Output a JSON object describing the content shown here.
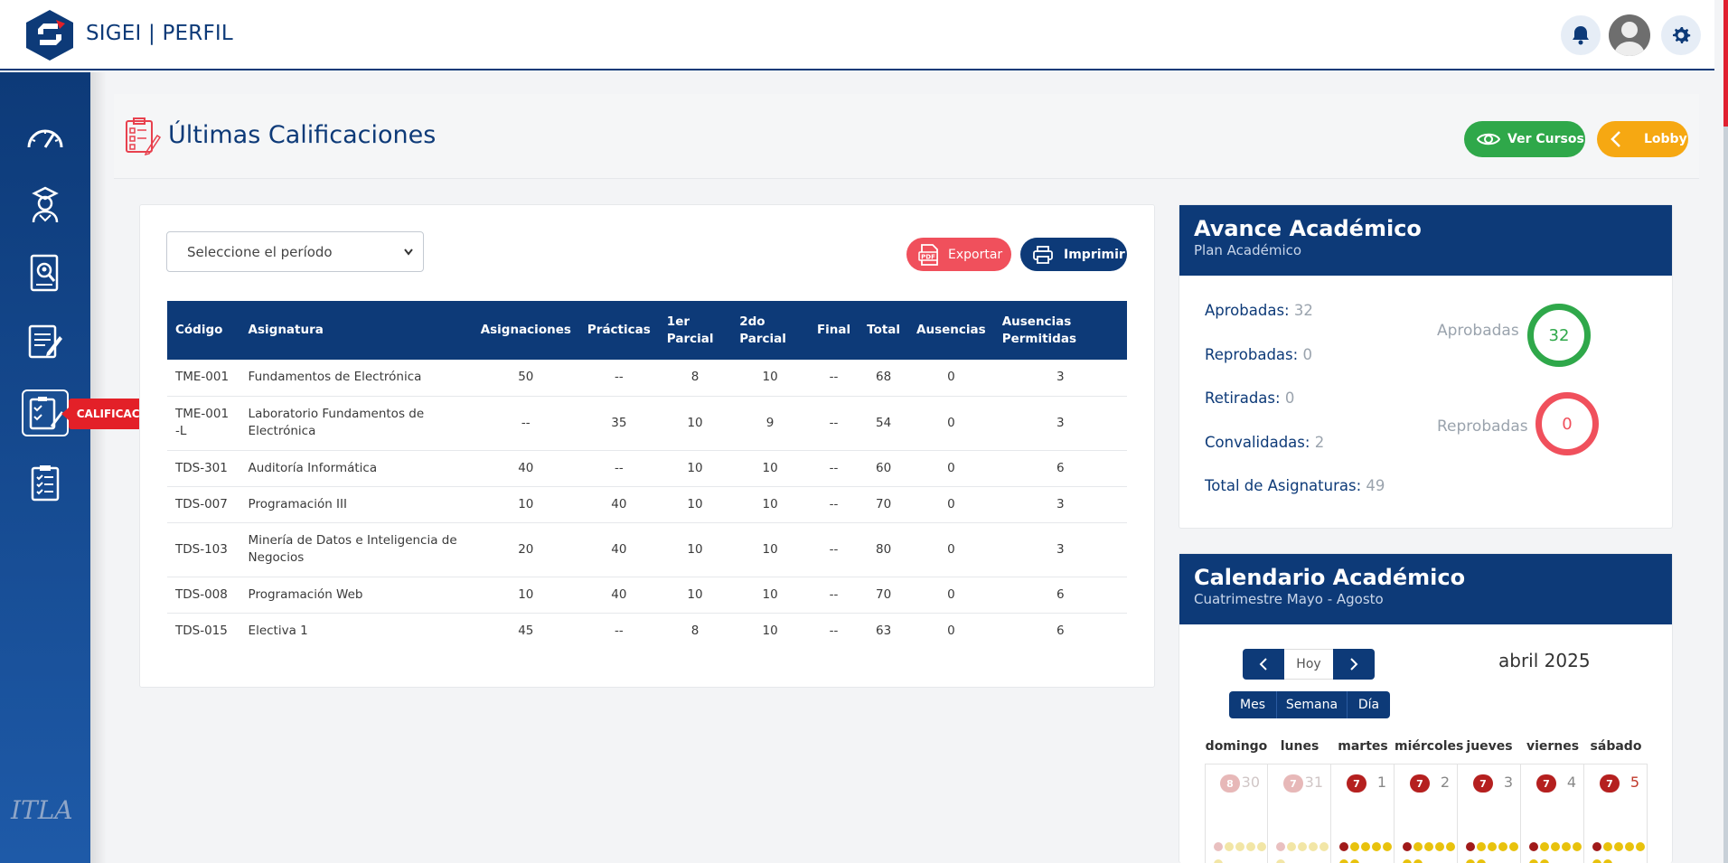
{
  "app": {
    "brand": "SIGEI | PERFIL"
  },
  "sidebar": {
    "tooltip": "CALIFICACIÓN",
    "items": [
      {
        "name": "dashboard"
      },
      {
        "name": "students"
      },
      {
        "name": "records"
      },
      {
        "name": "notes"
      },
      {
        "name": "grades"
      },
      {
        "name": "clipboard"
      }
    ],
    "footer_logo": "ITLA"
  },
  "header": {
    "title": "Últimas Calificaciones",
    "ver_cursos": "Ver Cursos",
    "lobby": "Lobby"
  },
  "filters": {
    "period_placeholder": "Seleccione el período",
    "export_label": "Exportar",
    "print_label": "Imprimir"
  },
  "table": {
    "headers": [
      "Código",
      "Asignatura",
      "Asignaciones",
      "Prácticas",
      "1er Parcial",
      "2do Parcial",
      "Final",
      "Total",
      "Ausencias",
      "Ausencias Permitidas"
    ],
    "rows": [
      [
        "TME-001",
        "Fundamentos de Electrónica",
        "50",
        "--",
        "8",
        "10",
        "--",
        "68",
        "0",
        "3"
      ],
      [
        "TME-001-L",
        "Laboratorio Fundamentos de Electrónica",
        "--",
        "35",
        "10",
        "9",
        "--",
        "54",
        "0",
        "3"
      ],
      [
        "TDS-301",
        "Auditoría Informática",
        "40",
        "--",
        "10",
        "10",
        "--",
        "60",
        "0",
        "6"
      ],
      [
        "TDS-007",
        "Programación III",
        "10",
        "40",
        "10",
        "10",
        "--",
        "70",
        "0",
        "3"
      ],
      [
        "TDS-103",
        "Minería de Datos e Inteligencia de Negocios",
        "20",
        "40",
        "10",
        "10",
        "--",
        "80",
        "0",
        "3"
      ],
      [
        "TDS-008",
        "Programación Web",
        "10",
        "40",
        "10",
        "10",
        "--",
        "70",
        "0",
        "6"
      ],
      [
        "TDS-015",
        "Electiva 1",
        "45",
        "--",
        "8",
        "10",
        "--",
        "63",
        "0",
        "6"
      ]
    ]
  },
  "avance": {
    "title": "Avance Académico",
    "subtitle": "Plan Académico",
    "aprobadas_label": "Aprobadas:",
    "aprobadas": "32",
    "reprobadas_label": "Reprobadas:",
    "reprobadas": "0",
    "retiradas_label": "Retiradas:",
    "retiradas": "0",
    "convalidadas_label": "Convalidadas:",
    "convalidadas": "2",
    "total_label": "Total de Asignaturas:",
    "total": "49",
    "ring_aprobadas_label": "Aprobadas",
    "ring_reprobadas_label": "Reprobadas",
    "colors": {
      "green": "#2fa84a",
      "red": "#f0505c"
    }
  },
  "calendar": {
    "title": "Calendario Académico",
    "subtitle": "Cuatrimestre Mayo - Agosto",
    "today_label": "Hoy",
    "month_label": "abril 2025",
    "views": [
      "Mes",
      "Semana",
      "Día"
    ],
    "weekdays": [
      "domingo",
      "lunes",
      "martes",
      "miércoles",
      "jueves",
      "viernes",
      "sábado"
    ],
    "days": [
      {
        "num": "30",
        "badge": "8",
        "faded": true
      },
      {
        "num": "31",
        "badge": "7",
        "faded": true
      },
      {
        "num": "1",
        "badge": "7",
        "faded": false
      },
      {
        "num": "2",
        "badge": "7",
        "faded": false
      },
      {
        "num": "3",
        "badge": "7",
        "faded": false
      },
      {
        "num": "4",
        "badge": "7",
        "faded": false
      },
      {
        "num": "5",
        "badge": "7",
        "faded": false
      }
    ]
  }
}
